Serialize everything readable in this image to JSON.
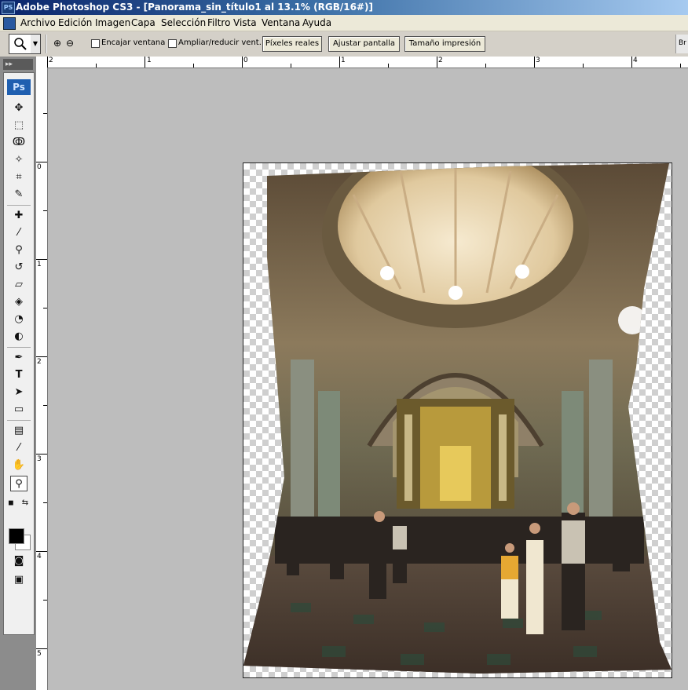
{
  "window": {
    "app_icon": "PS",
    "title": "Adobe Photoshop CS3 - [Panorama_sin_título1 al 13.1% (RGB/16#)]"
  },
  "menu": [
    "Archivo",
    "Edición",
    "Imagen",
    "Capa",
    "Selección",
    "Filtro",
    "Vista",
    "Ventana",
    "Ayuda"
  ],
  "options": {
    "fit_window_label": "Encajar ventana",
    "resize_window_label": "Ampliar/reducir vent.",
    "actual_pixels_label": "Píxeles reales",
    "fit_screen_label": "Ajustar pantalla",
    "print_size_label": "Tamaño impresión",
    "right_label": "Br"
  },
  "ruler": {
    "top_labels": [
      "2",
      "1",
      "0",
      "1",
      "2",
      "3",
      "4"
    ],
    "left_labels": [
      "0",
      "1",
      "2",
      "3",
      "4",
      "5"
    ]
  },
  "toolbox": {
    "logo": "Ps",
    "header": "▸▸",
    "tools": [
      "move-icon",
      "marquee-icon",
      "lasso-icon",
      "magic-wand-icon",
      "crop-icon",
      "slice-icon",
      "healing-brush-icon",
      "brush-icon",
      "clone-stamp-icon",
      "history-brush-icon",
      "eraser-icon",
      "paint-bucket-icon",
      "blur-icon",
      "dodge-icon",
      "pen-icon",
      "type-icon",
      "path-selection-icon",
      "rectangle-icon",
      "notes-icon",
      "eyedropper-icon",
      "hand-icon",
      "zoom-icon"
    ],
    "foreground_color": "#000000",
    "background_color": "#ffffff"
  },
  "document": {
    "image_name": "panorama-church-interior"
  }
}
